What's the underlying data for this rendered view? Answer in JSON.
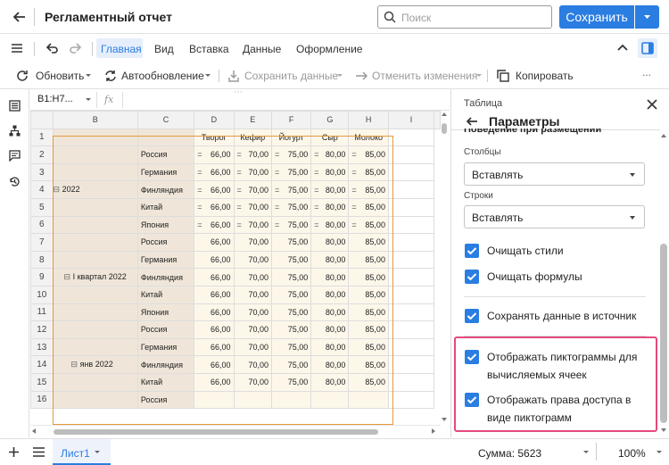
{
  "header": {
    "title": "Регламентный отчет",
    "search_placeholder": "Поиск",
    "save_label": "Сохранить"
  },
  "ribbon": {
    "tabs": [
      "Главная",
      "Вид",
      "Вставка",
      "Данные",
      "Оформление"
    ]
  },
  "toolbar": {
    "refresh": "Обновить",
    "autorefresh": "Автообновление",
    "save_data": "Сохранить данные",
    "cancel_changes": "Отменить изменения",
    "copy": "Копировать",
    "more": "..."
  },
  "formula": {
    "cell_ref": "B1:H7...",
    "fx": "fx"
  },
  "grid": {
    "columns": [
      "B",
      "C",
      "D",
      "E",
      "F",
      "G",
      "H",
      "I"
    ],
    "row_numbers": [
      "1",
      "2",
      "3",
      "4",
      "5",
      "6",
      "7",
      "8",
      "9",
      "10",
      "11",
      "12",
      "13",
      "14",
      "15",
      "16"
    ],
    "headers": [
      "Творог",
      "Кефир",
      "Йогурт",
      "Сыр",
      "Молоко"
    ],
    "groups": [
      "2022",
      "I квартал 2022",
      "янв 2022"
    ],
    "countries": [
      "Россия",
      "Германия",
      "Финляндия",
      "Китай",
      "Япония"
    ],
    "values_eq": [
      "66,00",
      "70,00",
      "75,00",
      "80,00",
      "85,00"
    ],
    "values": [
      "66,00",
      "70,00",
      "75,00",
      "80,00",
      "85,00"
    ],
    "partial_country": "Россия"
  },
  "panel": {
    "section": "Таблица",
    "title": "Параметры",
    "cut_heading": "Поведение при размещении",
    "columns_label": "Столбцы",
    "columns_value": "Вставлять",
    "rows_label": "Строки",
    "rows_value": "Вставлять",
    "cb_styles": "Очищать стили",
    "cb_formulas": "Очищать формулы",
    "cb_save_source": "Сохранять данные в источник",
    "cb_icons_1": "Отображать пиктограммы для",
    "cb_icons_2": "вычисляемых ячеек",
    "cb_access_1": "Отображать права доступа в",
    "cb_access_2": "виде пиктограмм"
  },
  "status": {
    "sheet": "Лист1",
    "sum": "Сумма: 5623",
    "zoom": "100%"
  },
  "colors": {
    "accent": "#2a7de1",
    "highlight": "#e6497c",
    "beige": "#efe6d9",
    "cream": "#fdf7ea",
    "selection": "#e39a3b"
  }
}
